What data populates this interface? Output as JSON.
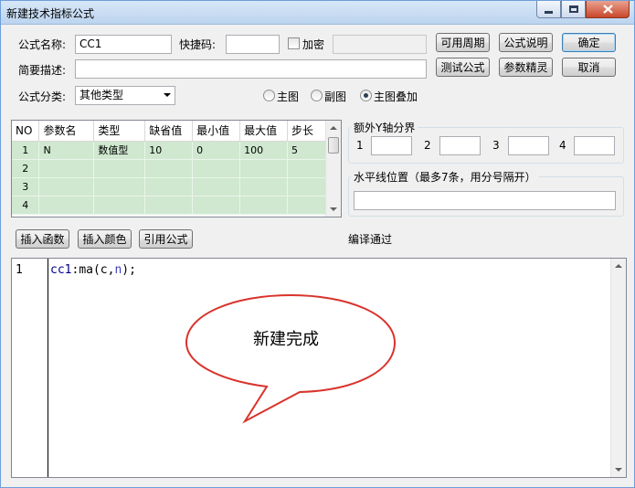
{
  "window": {
    "title": "新建技术指标公式"
  },
  "form": {
    "name_label": "公式名称:",
    "name_value": "CC1",
    "shortcut_label": "快捷码:",
    "shortcut_value": "",
    "encrypt_label": "加密",
    "encrypt_checked": false,
    "desc_label": "简要描述:",
    "desc_value": "",
    "category_label": "公式分类:",
    "category_value": "其他类型"
  },
  "buttons": {
    "available_periods": "可用周期",
    "formula_help": "公式说明",
    "ok": "确定",
    "test_formula": "测试公式",
    "param_wizard": "参数精灵",
    "cancel": "取消",
    "insert_function": "插入函数",
    "insert_color": "插入颜色",
    "reference_formula": "引用公式"
  },
  "chart_position": {
    "options": [
      "主图",
      "副图",
      "主图叠加"
    ],
    "selected": "主图叠加"
  },
  "param_table": {
    "headers": [
      "NO",
      "参数名",
      "类型",
      "缺省值",
      "最小值",
      "最大值",
      "步长"
    ],
    "rows": [
      [
        "1",
        "N",
        "数值型",
        "10",
        "0",
        "100",
        "5"
      ],
      [
        "2",
        "",
        "",
        "",
        "",
        "",
        ""
      ],
      [
        "3",
        "",
        "",
        "",
        "",
        "",
        ""
      ],
      [
        "4",
        "",
        "",
        "",
        "",
        "",
        ""
      ]
    ]
  },
  "extra_y_axis": {
    "title": "额外Y轴分界",
    "fields": [
      {
        "label": "1",
        "value": ""
      },
      {
        "label": "2",
        "value": ""
      },
      {
        "label": "3",
        "value": ""
      },
      {
        "label": "4",
        "value": ""
      }
    ]
  },
  "hline": {
    "title": "水平线位置（最多7条，用分号隔开）",
    "value": ""
  },
  "compile_status": "编译通过",
  "editor": {
    "line_number": "1",
    "code_ident": "cc1",
    "code_colon": ":",
    "code_func": "ma",
    "code_open": "(",
    "code_arg1": "c",
    "code_comma": ",",
    "code_arg2": "n",
    "code_close": ");"
  },
  "callout": {
    "text": "新建完成"
  }
}
